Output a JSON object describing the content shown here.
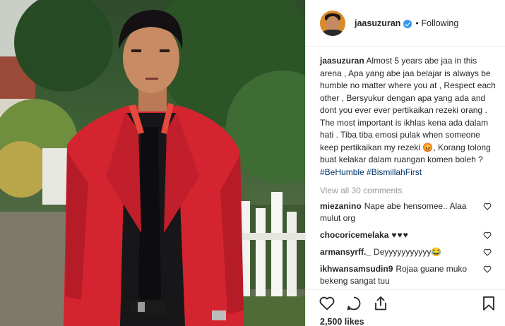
{
  "post": {
    "username": "jaasuzuran",
    "verified": true,
    "separator": "•",
    "follow_status": "Following",
    "caption": {
      "username": "jaasuzuran",
      "text": " Almost 5 years abe jaa in this arena , Apa yang abe jaa belajar is always be humble no matter where you at , Respect each other , Bersyukur dengan apa yang ada and dont you ever ever pertikaikan rezeki orang . The most important is ikhlas kena ada dalam hati . Tiba tiba emosi pulak when someone keep pertikaikan my rezeki 😡, Korang tolong buat kelakar dalam ruangan komen boleh ? ",
      "hashtags": [
        "#BeHumble",
        "#BismillahFirst"
      ]
    },
    "view_all_label": "View all 30 comments",
    "comments": [
      {
        "user": "miezanino",
        "text": "Nape abe hensomee.. Alaa mulut org"
      },
      {
        "user": "chocoricemelaka",
        "text": "♥♥♥"
      },
      {
        "user": "armansyrff._",
        "text": "Deyyyyyyyyyyy😂"
      },
      {
        "user": "ikhwansamsudin9",
        "text": "Rojaa guane muko bekeng sangat tuu"
      }
    ],
    "likes_label": "2,500 likes",
    "icons": {
      "like": "heart-icon",
      "comment": "comment-icon",
      "share": "share-icon",
      "save": "bookmark-icon",
      "verified": "verified-badge-icon"
    },
    "colors": {
      "verified": "#3897f0",
      "hashtag": "#003569",
      "muted": "#999999",
      "text": "#262626",
      "suit": "#d42430"
    }
  }
}
